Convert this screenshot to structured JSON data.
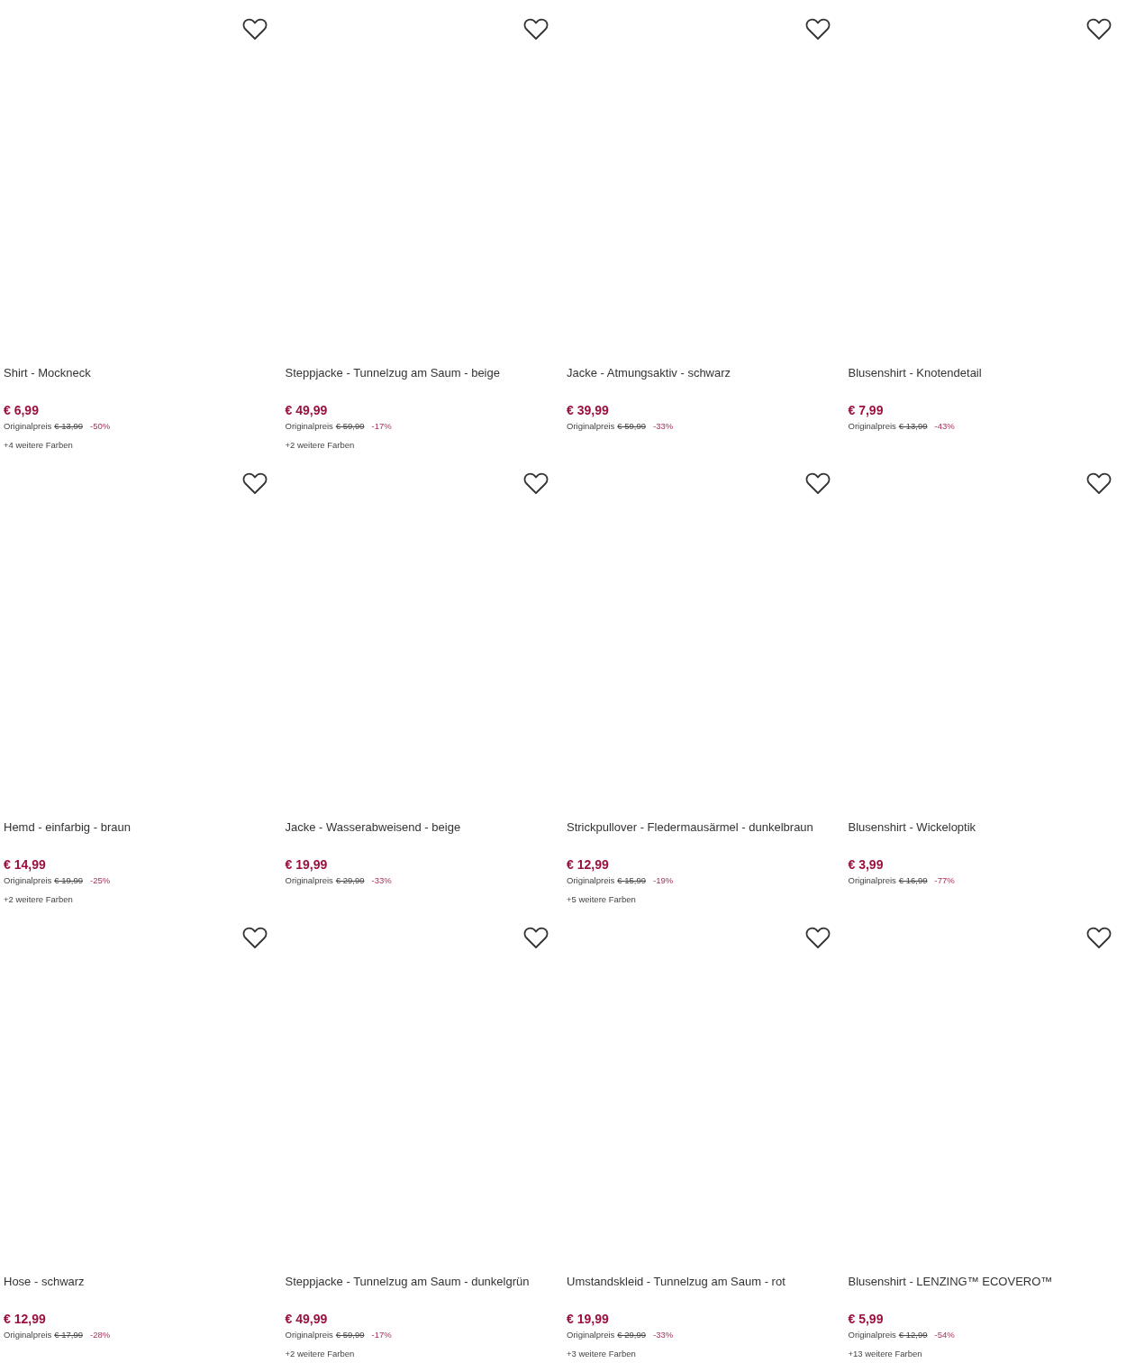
{
  "products": [
    {
      "title": "Shirt - Mockneck",
      "price": "€ 6,99",
      "original_label": "Originalpreis",
      "original_price": "€ 13,99",
      "discount": "-50%",
      "more_colors": "+4 weitere Farben"
    },
    {
      "title": "Steppjacke - Tunnelzug am Saum - beige",
      "price": "€ 49,99",
      "original_label": "Originalpreis",
      "original_price": "€ 59,99",
      "discount": "-17%",
      "more_colors": "+2 weitere Farben"
    },
    {
      "title": "Jacke - Atmungsaktiv - schwarz",
      "price": "€ 39,99",
      "original_label": "Originalpreis",
      "original_price": "€ 59,99",
      "discount": "-33%"
    },
    {
      "title": "Blusenshirt - Knotendetail",
      "price": "€ 7,99",
      "original_label": "Originalpreis",
      "original_price": "€ 13,99",
      "discount": "-43%"
    },
    {
      "title": "Hemd - einfarbig - braun",
      "price": "€ 14,99",
      "original_label": "Originalpreis",
      "original_price": "€ 19,99",
      "discount": "-25%",
      "more_colors": "+2 weitere Farben"
    },
    {
      "title": "Jacke - Wasserabweisend - beige",
      "price": "€ 19,99",
      "original_label": "Originalpreis",
      "original_price": "€ 29,99",
      "discount": "-33%"
    },
    {
      "title": "Strickpullover - Fledermausärmel - dunkelbraun",
      "price": "€ 12,99",
      "original_label": "Originalpreis",
      "original_price": "€ 15,99",
      "discount": "-19%",
      "more_colors": "+5 weitere Farben"
    },
    {
      "title": "Blusenshirt - Wickeloptik",
      "price": "€ 3,99",
      "original_label": "Originalpreis",
      "original_price": "€ 16,99",
      "discount": "-77%"
    },
    {
      "title": "Hose - schwarz",
      "price": "€ 12,99",
      "original_label": "Originalpreis",
      "original_price": "€ 17,99",
      "discount": "-28%"
    },
    {
      "title": "Steppjacke - Tunnelzug am Saum - dunkelgrün",
      "price": "€ 49,99",
      "original_label": "Originalpreis",
      "original_price": "€ 59,99",
      "discount": "-17%",
      "more_colors": "+2 weitere Farben"
    },
    {
      "title": "Umstandskleid - Tunnelzug am Saum - rot",
      "price": "€ 19,99",
      "original_label": "Originalpreis",
      "original_price": "€ 29,99",
      "discount": "-33%",
      "more_colors": "+3 weitere Farben"
    },
    {
      "title": "Blusenshirt - LENZING™ ECOVERO™",
      "price": "€ 5,99",
      "original_label": "Originalpreis",
      "original_price": "€ 12,99",
      "discount": "-54%",
      "more_colors": "+13 weitere Farben"
    }
  ]
}
